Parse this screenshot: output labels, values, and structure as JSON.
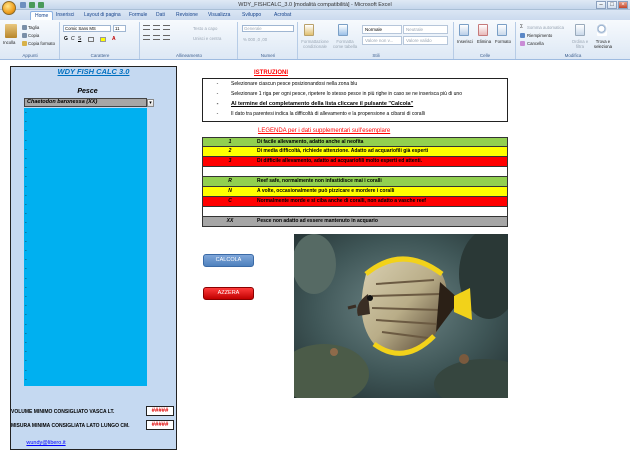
{
  "window": {
    "title": "WDY_FISHCALC_3.0  [modalità compatibilità] - Microsoft Excel",
    "controls": [
      "–",
      "□",
      "×"
    ]
  },
  "ribbon": {
    "tabs": [
      "Home",
      "Inserisci",
      "Layout di pagina",
      "Formule",
      "Dati",
      "Revisione",
      "Visualizza",
      "Sviluppo",
      "Acrobat"
    ],
    "active_tab": "Home",
    "clipboard": {
      "paste": "Incolla",
      "cut": "Taglia",
      "copy": "Copia",
      "format_painter": "Copia formato",
      "label": "Appunti"
    },
    "font": {
      "name": "Comic Sans MS",
      "size": "11",
      "label": "Carattere"
    },
    "alignment": {
      "wrap": "Testo a capo",
      "merge": "Unisci e centra",
      "label": "Allineamento"
    },
    "number": {
      "format": "Generale",
      "label": "Numeri"
    },
    "styles": {
      "conditional": "Formattazione condizionale",
      "as_table": "Formatta come tabella",
      "normal": "Normale",
      "wrong": "Valore non v...",
      "bad": "Neutrale",
      "good": "Valore valido",
      "label": "Stili"
    },
    "cells": {
      "insert": "Inserisci",
      "delete": "Elimina",
      "format": "Formato",
      "label": "Celle"
    },
    "editing": {
      "autosum": "Somma automatica",
      "fill": "Riempimento",
      "clear": "Cancella",
      "sort": "Ordina e filtra",
      "find": "Trova e seleziona",
      "label": "Modifica"
    }
  },
  "left_panel": {
    "title": "WDY FISH CALC 3.0",
    "pesce_header": "Pesce",
    "selected_fish": "Chaetodon baronessa (XX)",
    "list_rows": 30,
    "volume_label": "VOLUME MINIMO CONSIGLIATO VASCA LT.",
    "volume_value": "#####",
    "length_label": "MISURA MINIMA CONSIGLIATA LATO LUNGO CM.",
    "length_value": "#####",
    "email": "wundy@libero.it"
  },
  "instructions": {
    "title": "ISTRUZIONI",
    "rows": [
      {
        "text": "Selezionare ciascun pesce posizionandosi nella zona blu",
        "bold": false
      },
      {
        "text": "Selezionare 1 riga per ogni pesce, ripetere lo stesso pesce in più righe in caso se ne inserisca più di uno",
        "bold": false
      },
      {
        "text": "Al termine del completamento della lista cliccare il pulsante \"Calcola\"",
        "bold": true
      },
      {
        "text": "Il dato tra parentesi indica la difficoltà di allevamento e la propensione a cibarsi di coralli",
        "bold": false
      }
    ]
  },
  "legend": {
    "title": "LEGENDA per i dati supplementari sull'esemplare",
    "rows": [
      {
        "code": "1",
        "text": "Di facile allevamento, adatto anche al neofita",
        "color": "#92d050"
      },
      {
        "code": "2",
        "text": "Di media difficoltà, richiede attenzione. Adatto ad acquariofili già esperti",
        "color": "#ffff00"
      },
      {
        "code": "3",
        "text": "Di difficile allevamento, adatto ad acquariofili molto esperti ed attenti.",
        "color": "#ff0000"
      },
      {
        "code": "",
        "text": "",
        "color": "#ffffff"
      },
      {
        "code": "R",
        "text": "Reef safe, normalmente non infastidisce mai i coralli",
        "color": "#92d050"
      },
      {
        "code": "N",
        "text": "A volte, occasionalmente può pizzicare e mordere i coralli",
        "color": "#ffff00"
      },
      {
        "code": "C",
        "text": "Normalmente morde e si ciba anche di coralli, non adatto a vasche reef",
        "color": "#ff0000"
      },
      {
        "code": "",
        "text": "",
        "color": "#ffffff"
      },
      {
        "code": "XX",
        "text": "Pesce non adatto ad essere mantenuto in acquario",
        "color": "#a6a6a6"
      }
    ]
  },
  "buttons": {
    "calcola": "CALCOLA",
    "azzera": "AZZERA"
  }
}
